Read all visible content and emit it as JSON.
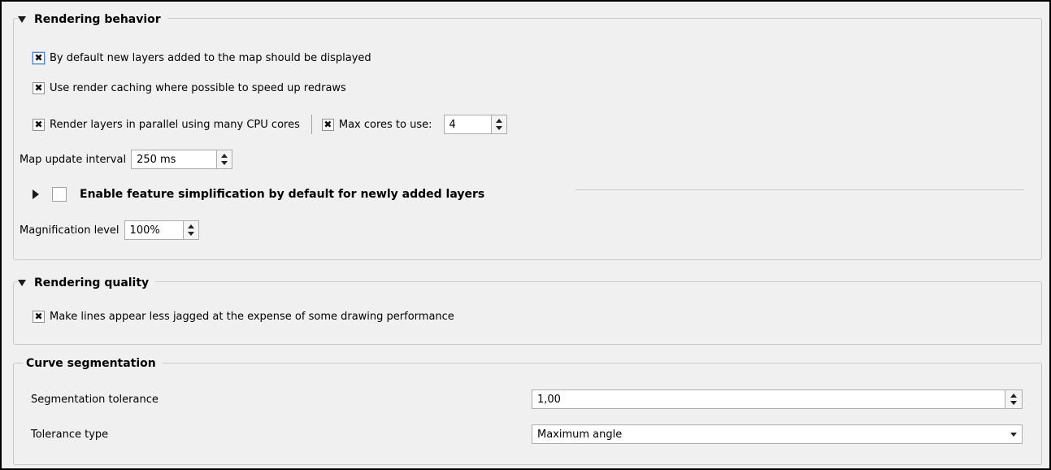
{
  "rendering_behavior": {
    "title": "Rendering behavior",
    "show_new_layers": {
      "label": "By default new layers added to the map should be displayed",
      "checked": true
    },
    "render_caching": {
      "label": "Use render caching where possible to speed up redraws",
      "checked": true
    },
    "parallel": {
      "label": "Render layers in parallel using many CPU cores",
      "checked": true
    },
    "max_cores": {
      "label": "Max cores to use:",
      "checked": true,
      "value": "4"
    },
    "map_update": {
      "label": "Map update interval",
      "value": "250 ms"
    },
    "simplification": {
      "label": "Enable feature simplification by default for newly added layers",
      "checked": false
    },
    "magnification": {
      "label": "Magnification level",
      "value": "100%"
    }
  },
  "rendering_quality": {
    "title": "Rendering quality",
    "antialias": {
      "label": "Make lines appear less jagged at the expense of some drawing performance",
      "checked": true
    }
  },
  "curve_segmentation": {
    "title": "Curve segmentation",
    "tolerance": {
      "label": "Segmentation tolerance",
      "value": "1,00"
    },
    "tolerance_type": {
      "label": "Tolerance type",
      "value": "Maximum angle"
    }
  }
}
